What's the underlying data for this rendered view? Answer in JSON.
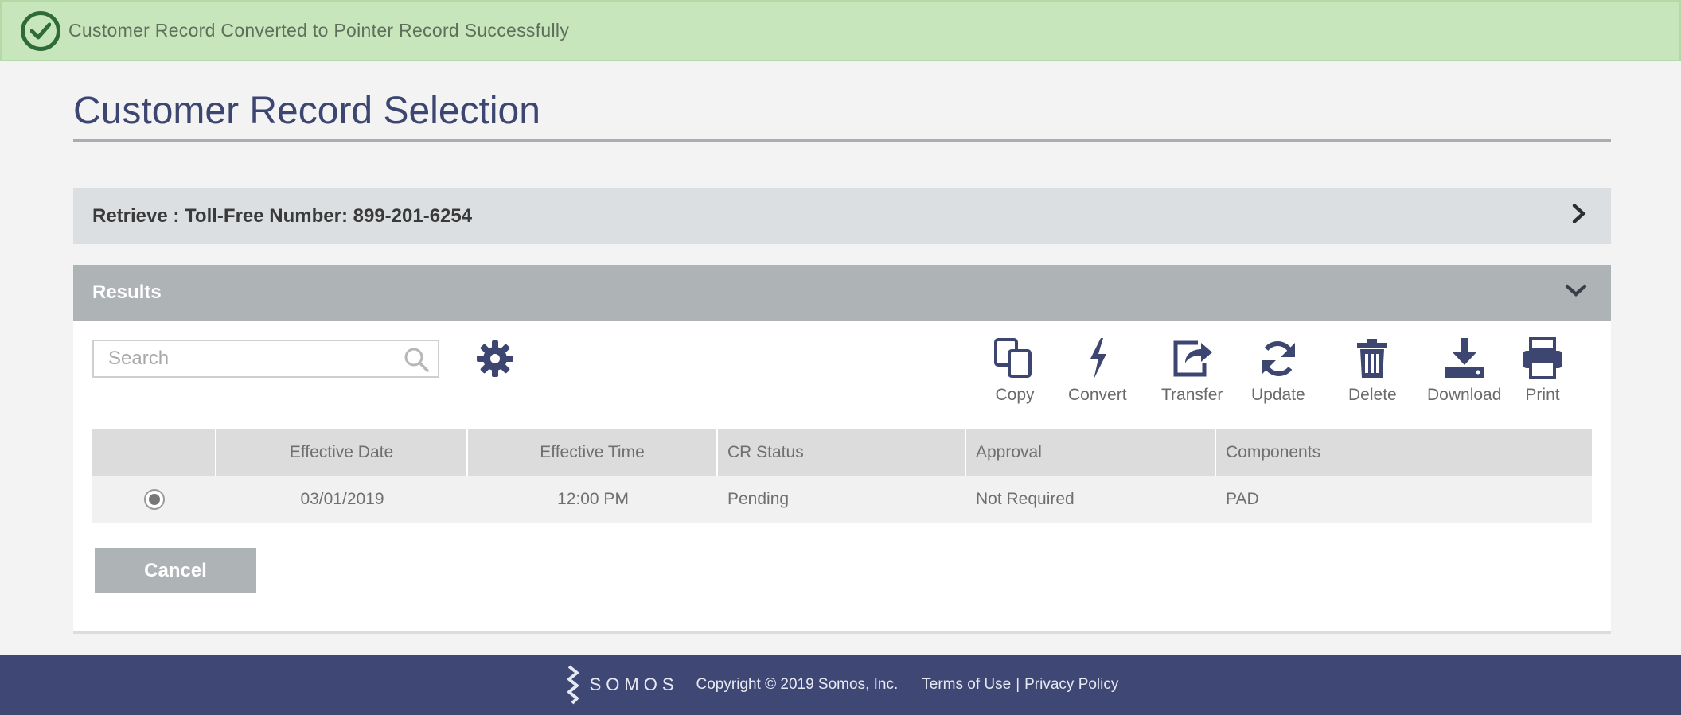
{
  "banner": {
    "message": "Customer Record Converted to Pointer Record Successfully",
    "icon": "check-circle-icon"
  },
  "page": {
    "title": "Customer Record Selection"
  },
  "retrieve": {
    "label": "Retrieve : Toll-Free Number: 899-201-6254",
    "icon": "chevron-right-icon"
  },
  "results": {
    "label": "Results",
    "icon": "chevron-down-icon"
  },
  "search": {
    "placeholder": "Search",
    "value": ""
  },
  "toolbar": {
    "settings_icon": "gear-icon",
    "actions": [
      {
        "label": "Copy",
        "icon": "copy-icon"
      },
      {
        "label": "Convert",
        "icon": "lightning-icon"
      },
      {
        "label": "Transfer",
        "icon": "share-icon"
      },
      {
        "label": "Update",
        "icon": "refresh-icon"
      },
      {
        "label": "Delete",
        "icon": "trash-icon"
      },
      {
        "label": "Download",
        "icon": "download-icon"
      },
      {
        "label": "Print",
        "icon": "printer-icon"
      }
    ]
  },
  "table": {
    "columns": [
      "",
      "Effective Date",
      "Effective Time",
      "CR Status",
      "Approval",
      "Components"
    ],
    "rows": [
      {
        "selected": true,
        "effective_date": "03/01/2019",
        "effective_time": "12:00 PM",
        "cr_status": "Pending",
        "approval": "Not Required",
        "components": "PAD"
      }
    ]
  },
  "cancel_label": "Cancel",
  "footer": {
    "brand": "SOMOS",
    "copyright": "Copyright © 2019 Somos, Inc.",
    "terms": "Terms of Use",
    "separator": "|",
    "privacy": "Privacy Policy"
  },
  "colors": {
    "banner_bg": "#c8e6bc",
    "title": "#3d4670",
    "results_bar": "#aeb3b6",
    "icon_navy": "#3d4670",
    "footer_bg": "#3f4874"
  }
}
